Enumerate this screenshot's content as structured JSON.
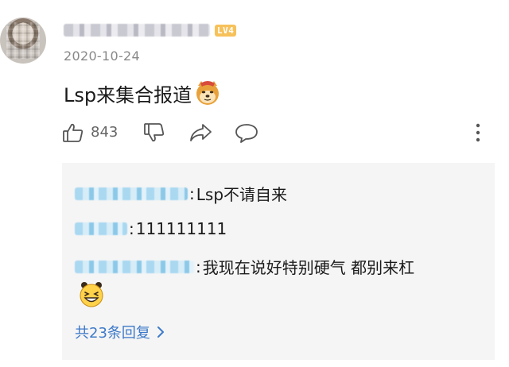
{
  "comment": {
    "level_badge": "LV4",
    "date": "2020-10-24",
    "text": "Lsp来集合报道",
    "emoji": "doge-emoji"
  },
  "actions": {
    "like_count": "843",
    "icons": [
      "thumbs-up-icon",
      "thumbs-down-icon",
      "share-icon",
      "reply-icon",
      "more-icon"
    ]
  },
  "replies": {
    "items": [
      {
        "text": "Lsp不请自来"
      },
      {
        "text": "111111111"
      },
      {
        "text": "我现在说好特别硬气 都别来杠"
      }
    ],
    "view_all_label": "共23条回复"
  },
  "colors": {
    "link": "#3c79c9",
    "badge": "#f7c15a",
    "panel_bg": "#f5f5f5"
  }
}
